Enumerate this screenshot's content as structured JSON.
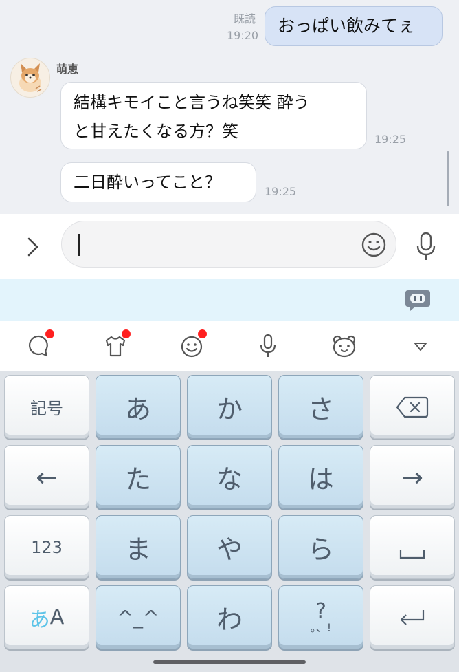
{
  "chat": {
    "sent": {
      "text": "おっぱい飲みてぇ",
      "read_label": "既読",
      "time": "19:20"
    },
    "sender": {
      "name": "萌恵"
    },
    "received": [
      {
        "line1": "結構キモイこと言うね笑笑 酔う",
        "line2": "と甘えたくなる方？笑",
        "time": "19:25"
      },
      {
        "text": "二日酔いってこと？",
        "time": "19:25"
      }
    ]
  },
  "input": {
    "value": "",
    "placeholder": ""
  },
  "toolbar": {
    "items": [
      "chat-bubble-icon",
      "tshirt-icon",
      "smiley-icon",
      "mic-icon",
      "bear-face-icon",
      "triangle-down-icon"
    ],
    "badge_color": "#ff1f1f"
  },
  "keyboard": {
    "left_keys": [
      "記号",
      "←",
      "123"
    ],
    "mode_key": {
      "kana": "あ",
      "latin": "A"
    },
    "kana_keys": [
      "あ",
      "か",
      "さ",
      "た",
      "な",
      "は",
      "ま",
      "や",
      "ら",
      "^_^",
      "わ",
      "?",
      "。、!"
    ],
    "right_keys": [
      "backspace-icon",
      "→",
      "space-icon",
      "enter-icon"
    ]
  },
  "colors": {
    "chat_bg": "#eef0f4",
    "sent_bubble": "#d7e3f6",
    "suggest_strip": "#e3f4fc",
    "key_blue": "#c9e0ef",
    "key_text": "#4f5d6c",
    "mode_kana": "#5ec4e8"
  }
}
